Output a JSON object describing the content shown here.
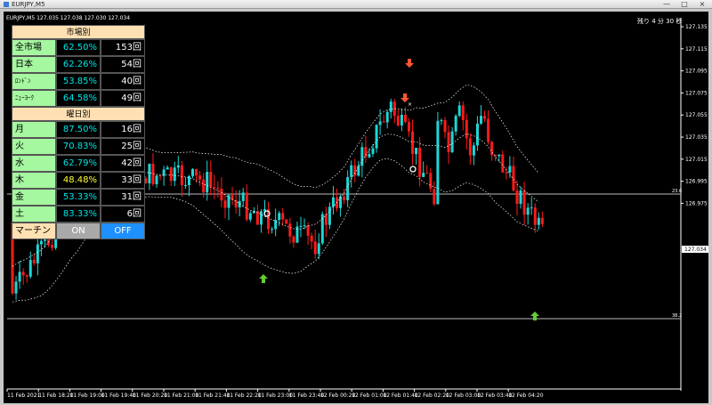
{
  "window": {
    "title": "EURJPY,M5",
    "controls": [
      "—",
      "□",
      "×"
    ]
  },
  "chart": {
    "symbol_line": "EURJPY,M5  127.035 127.038 127.030 127.034",
    "countdown": "残り 4 分 30 秒",
    "current_price": "127.034",
    "line_upper_label": "23.6",
    "line_lower_label": "38.2",
    "price_ticks": [
      "127.135",
      "127.115",
      "127.095",
      "127.075",
      "127.055",
      "127.035",
      "127.015",
      "126.995",
      "126.975"
    ],
    "time_ticks": [
      "11 Feb 2021",
      "11 Feb 18:20",
      "11 Feb 19:00",
      "11 Feb 19:40",
      "11 Feb 20:20",
      "11 Feb 21:00",
      "11 Feb 21:40",
      "11 Feb 22:20",
      "11 Feb 23:00",
      "11 Feb 23:40",
      "12 Feb 00:20",
      "12 Feb 01:00",
      "12 Feb 01:40",
      "12 Feb 02:20",
      "12 Feb 03:00",
      "12 Feb 03:40",
      "12 Feb 04:20"
    ],
    "colors": {
      "bull": "#1fd6d6",
      "bear": "#ff1a1a",
      "band": "#ffffff",
      "arrow_up": "#66cc33",
      "arrow_down": "#ff5533"
    }
  },
  "stats": {
    "market_header": "市場別",
    "markets": [
      {
        "name": "全市場",
        "rate": "62.50%",
        "count": "153回"
      },
      {
        "name": "日本",
        "rate": "62.26%",
        "count": "54回"
      },
      {
        "name": "ﾛﾝﾄﾞﾝ",
        "rate": "53.85%",
        "count": "40回"
      },
      {
        "name": "ﾆｭｰﾖｰｸ",
        "rate": "64.58%",
        "count": "49回"
      }
    ],
    "weekday_header": "曜日別",
    "weekdays": [
      {
        "name": "月",
        "rate": "87.50%",
        "count": "16回"
      },
      {
        "name": "火",
        "rate": "70.83%",
        "count": "25回"
      },
      {
        "name": "水",
        "rate": "62.79%",
        "count": "42回"
      },
      {
        "name": "木",
        "rate": "48.48%",
        "count": "33回"
      },
      {
        "name": "金",
        "rate": "53.33%",
        "count": "31回"
      },
      {
        "name": "土",
        "rate": "83.33%",
        "count": "6回"
      }
    ],
    "martingale": {
      "label": "マーチン",
      "on": "ON",
      "off": "OFF"
    }
  }
}
